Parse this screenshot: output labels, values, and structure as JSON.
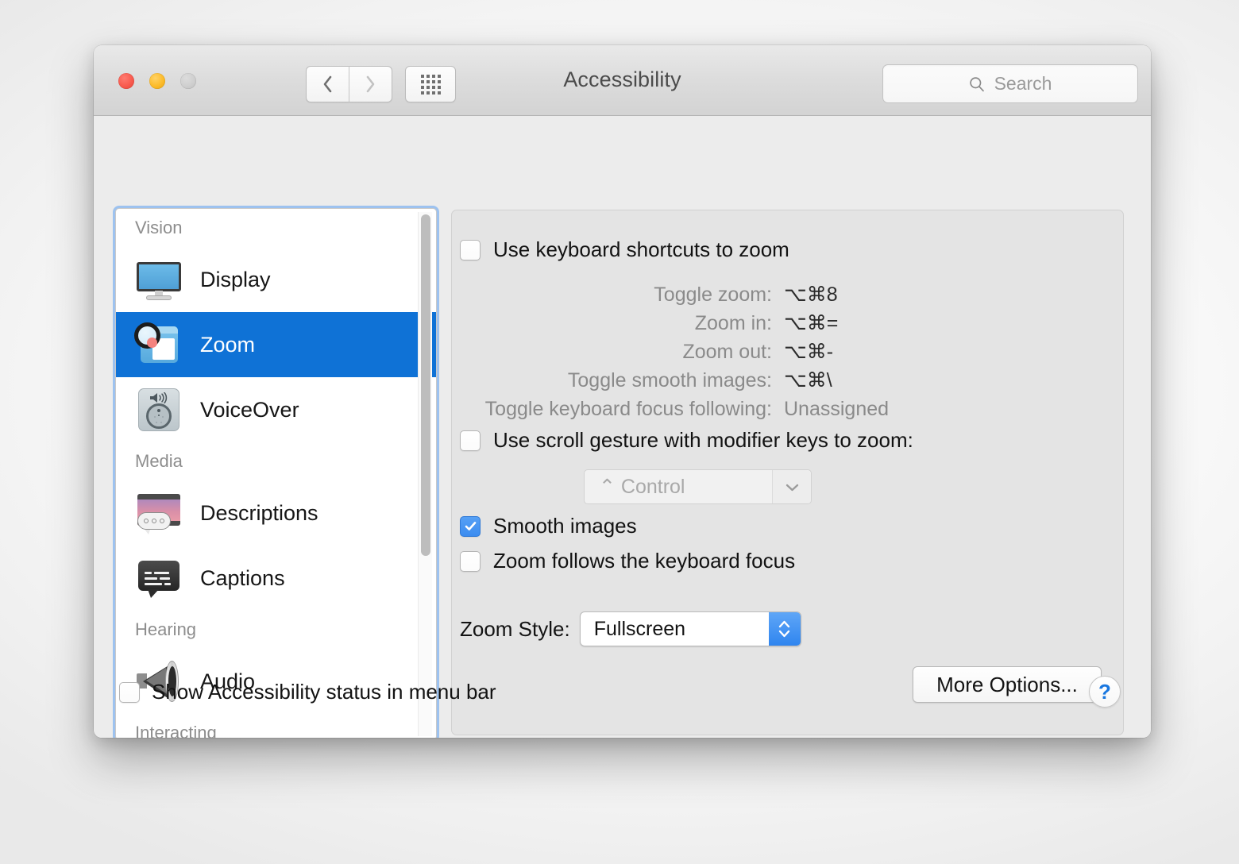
{
  "window": {
    "title": "Accessibility",
    "traffic_lights": [
      "close",
      "minimize",
      "zoom"
    ]
  },
  "toolbar": {
    "back_label": "Back",
    "forward_label": "Forward",
    "show_all_label": "Show All",
    "search_placeholder": "Search",
    "search_value": ""
  },
  "sidebar": {
    "groups": [
      {
        "label": "Vision",
        "items": [
          {
            "label": "Display",
            "icon": "display-icon",
            "selected": false
          },
          {
            "label": "Zoom",
            "icon": "zoom-icon",
            "selected": true
          },
          {
            "label": "VoiceOver",
            "icon": "voiceover-icon",
            "selected": false
          }
        ]
      },
      {
        "label": "Media",
        "items": [
          {
            "label": "Descriptions",
            "icon": "descriptions-icon",
            "selected": false
          },
          {
            "label": "Captions",
            "icon": "captions-icon",
            "selected": false
          }
        ]
      },
      {
        "label": "Hearing",
        "items": [
          {
            "label": "Audio",
            "icon": "audio-icon",
            "selected": false
          }
        ]
      },
      {
        "label": "Interacting",
        "items": []
      }
    ],
    "selection_color": "#0f72d6",
    "focus_ring_color": "#6ca8f0"
  },
  "main": {
    "keyboard_shortcuts_checkbox": {
      "label": "Use keyboard shortcuts to zoom",
      "checked": false
    },
    "shortcuts": [
      {
        "name": "Toggle zoom:",
        "value": "⌥⌘8",
        "unassigned": false
      },
      {
        "name": "Zoom in:",
        "value": "⌥⌘=",
        "unassigned": false
      },
      {
        "name": "Zoom out:",
        "value": "⌥⌘-",
        "unassigned": false
      },
      {
        "name": "Toggle smooth images:",
        "value": "⌥⌘\\",
        "unassigned": false
      },
      {
        "name": "Toggle keyboard focus following:",
        "value": "Unassigned",
        "unassigned": true
      }
    ],
    "scroll_gesture_checkbox": {
      "label": "Use scroll gesture with modifier keys to zoom:",
      "checked": false
    },
    "modifier_select": {
      "value": "⌃ Control",
      "disabled": true
    },
    "smooth_images_checkbox": {
      "label": "Smooth images",
      "checked": true
    },
    "zoom_follows_focus_checkbox": {
      "label": "Zoom follows the keyboard focus",
      "checked": false
    },
    "zoom_style": {
      "label": "Zoom Style:",
      "value": "Fullscreen"
    },
    "more_options_button": "More Options..."
  },
  "footer": {
    "status_checkbox": {
      "label": "Show Accessibility status in menu bar",
      "checked": false
    },
    "help_button": "?"
  }
}
